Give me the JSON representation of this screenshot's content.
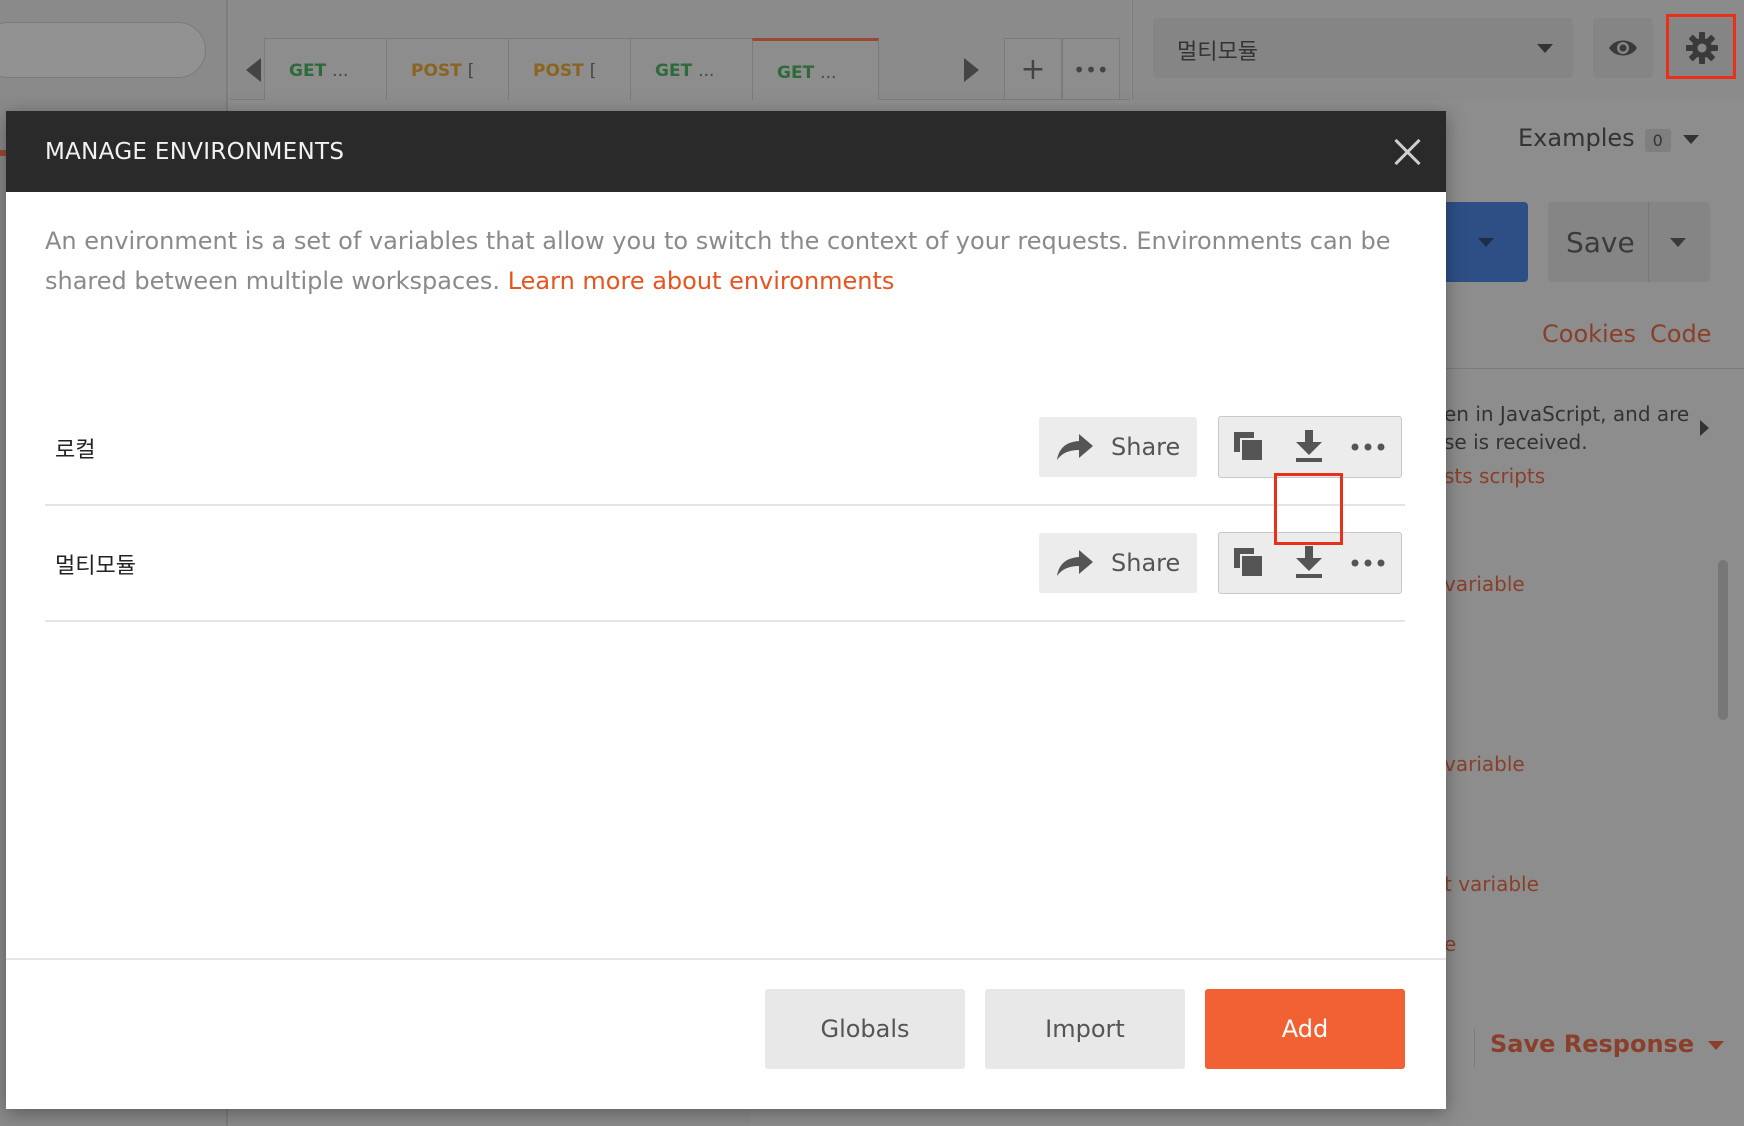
{
  "app": {
    "tabs": [
      {
        "method": "GET",
        "rest": "..."
      },
      {
        "method": "POST",
        "rest": "["
      },
      {
        "method": "POST",
        "rest": "["
      },
      {
        "method": "GET",
        "rest": "..."
      },
      {
        "method": "GET",
        "rest": "..."
      }
    ],
    "tab_add": "+",
    "tab_more": "•••",
    "env_selector_value": "멀티모듈",
    "examples_label": "Examples",
    "examples_count": "0",
    "save_label": "Save",
    "cookies_label": "Cookies",
    "code_label": "Code",
    "right_panel_text": [
      "en in JavaScript, and are",
      "se is received."
    ],
    "right_panel_links": [
      "sts scripts",
      "variable",
      "variable",
      "t variable",
      "e"
    ],
    "save_response_label": "Save Response",
    "colors": {
      "accent": "#f26133",
      "link": "#e8541f",
      "highlight": "#e8301b"
    }
  },
  "modal": {
    "title": "MANAGE ENVIRONMENTS",
    "description": "An environment is a set of variables that allow you to switch the context of your requests. Environments can be shared between multiple workspaces.",
    "learn_more_link": "Learn more about environments",
    "environments": [
      {
        "name": "로컬",
        "share_label": "Share"
      },
      {
        "name": "멀티모듈",
        "share_label": "Share"
      }
    ],
    "buttons": {
      "globals": "Globals",
      "import": "Import",
      "add": "Add"
    }
  }
}
